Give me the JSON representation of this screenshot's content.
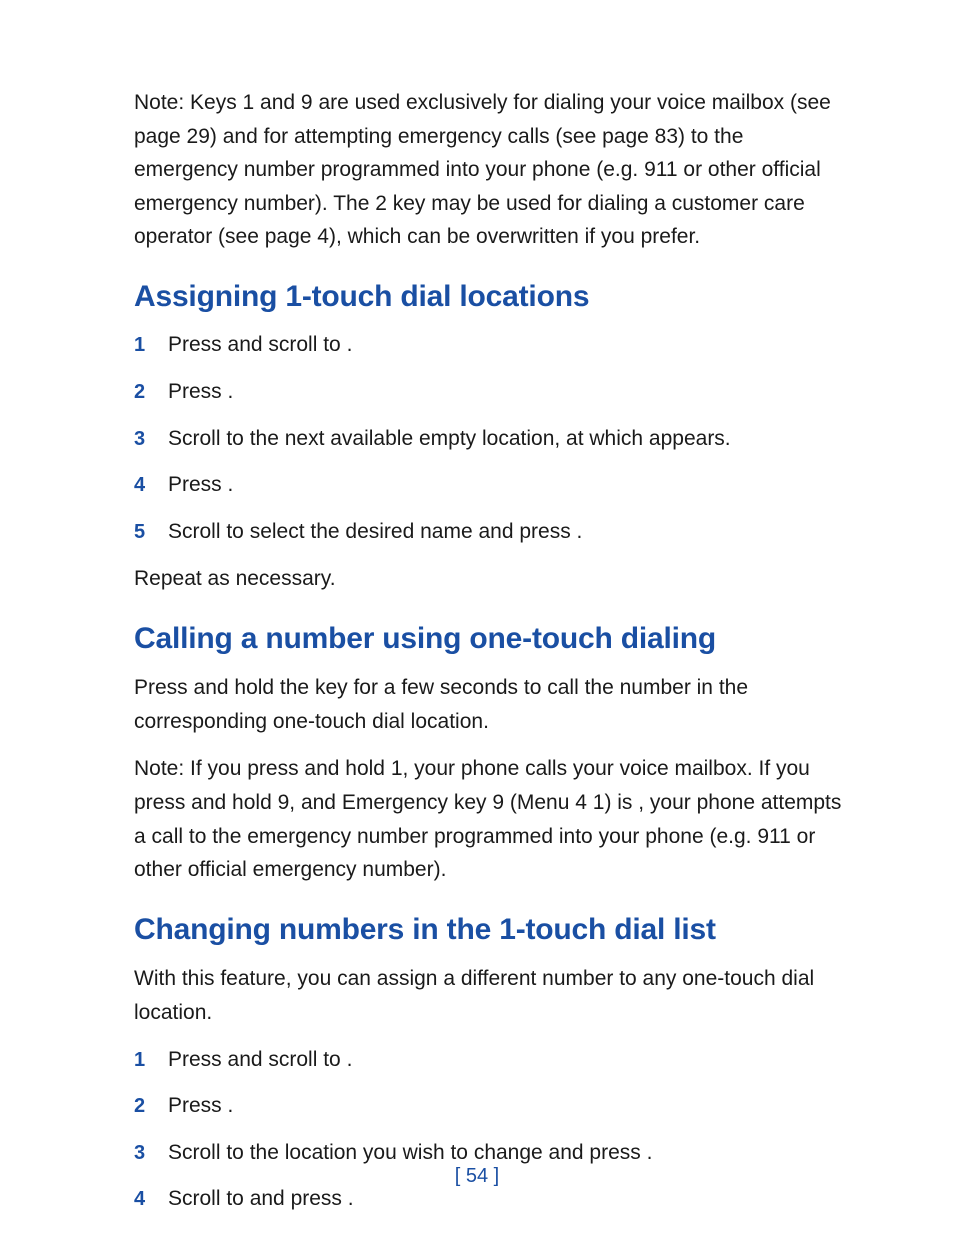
{
  "intro_note": "Note: Keys 1 and 9 are used exclusively for dialing your voice mailbox (see page 29) and for attempting emergency calls (see page 83) to the emergency number programmed into your phone (e.g. 911 or other official emergency number). The 2 key may be used for dialing a customer care operator (see page 4), which can be overwritten if you prefer.",
  "section1": {
    "heading": "Assigning 1-touch dial locations",
    "steps": [
      "Press           and scroll to                              .",
      "Press            .",
      "Scroll to the next available empty location, at which               appears.",
      "Press            .",
      "Scroll to select the desired name and press             ."
    ],
    "after": "Repeat as necessary."
  },
  "section2": {
    "heading": "Calling a number using one-touch dialing",
    "para1": "Press and hold the key for a few seconds to call the number in the corresponding one-touch dial location.",
    "para2": "Note: If you press and hold 1, your phone calls your voice mailbox. If you press and hold 9, and Emergency key 9 (Menu 4 1) is     , your phone attempts a call to the emergency number programmed into your phone (e.g. 911 or other official emergency number)."
  },
  "section3": {
    "heading": "Changing numbers in the 1-touch dial list",
    "para": "With this feature, you can assign a different number to any one-touch dial location.",
    "steps": [
      "Press           and scroll to                              .",
      "Press            .",
      "Scroll to the location you wish to change and press              .",
      "Scroll to             and press              ."
    ]
  },
  "page_number": "[ 54 ]"
}
